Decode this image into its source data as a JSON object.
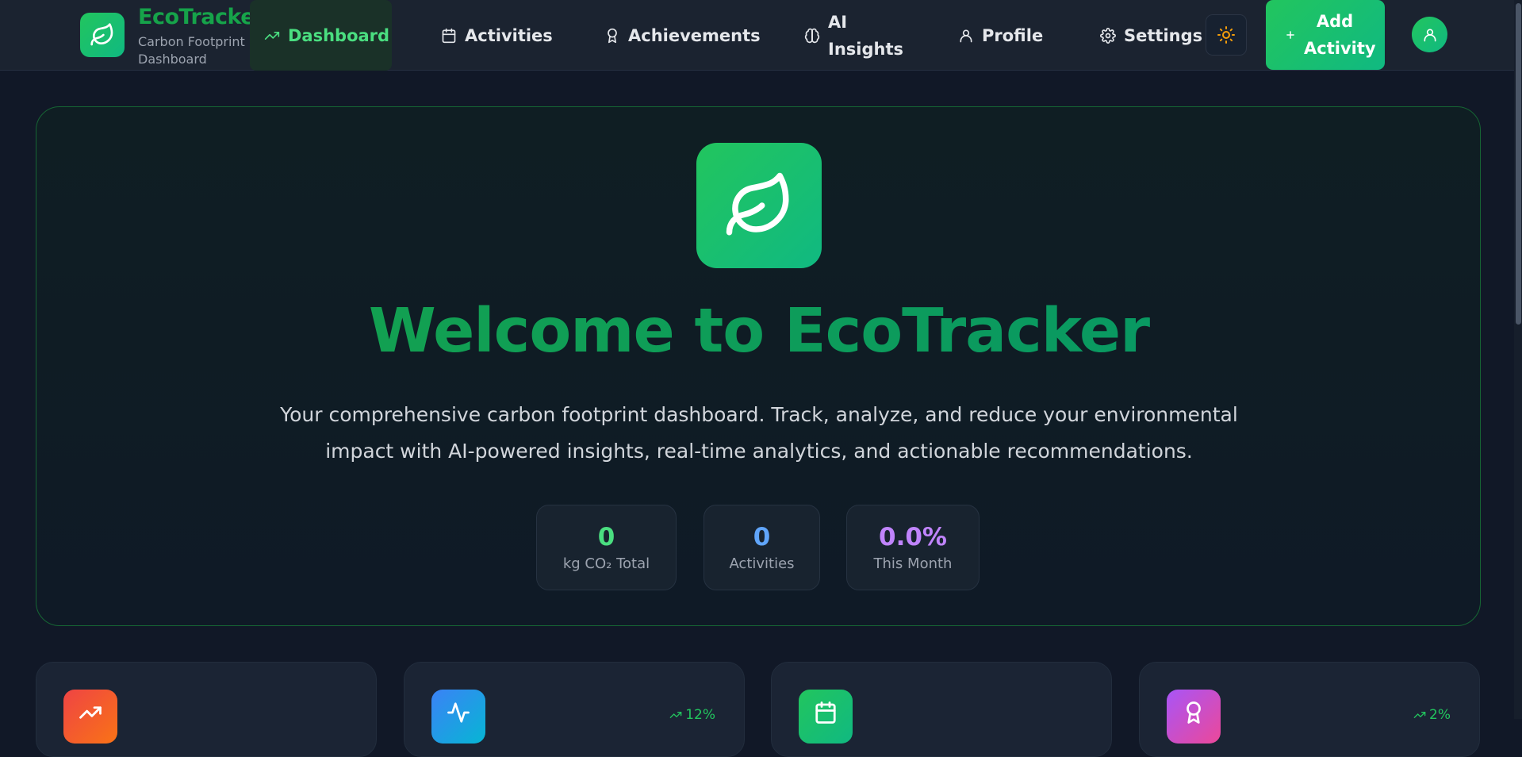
{
  "brand": {
    "name": "EcoTracker",
    "subtitle": "Carbon Footprint Dashboard",
    "icon": "leaf-icon"
  },
  "nav": {
    "items": [
      {
        "label": "Dashboard",
        "icon": "trending-up-icon",
        "active": true
      },
      {
        "label": "Activities",
        "icon": "calendar-icon",
        "active": false
      },
      {
        "label": "Achievements",
        "icon": "award-icon",
        "active": false
      },
      {
        "label": "AI Insights",
        "icon": "brain-icon",
        "active": false
      },
      {
        "label": "Profile",
        "icon": "user-icon",
        "active": false
      },
      {
        "label": "Settings",
        "icon": "gear-icon",
        "active": false
      }
    ],
    "theme_toggle_icon": "sun-icon",
    "add_activity_label": "Add Activity",
    "add_activity_icon": "plus-icon",
    "avatar_icon": "user-icon"
  },
  "hero": {
    "title": "Welcome to EcoTracker",
    "description": "Your comprehensive carbon footprint dashboard. Track, analyze, and reduce your environmental impact with AI-powered insights, real-time analytics, and actionable recommendations.",
    "stats": [
      {
        "value": "0",
        "label": "kg CO₂ Total",
        "color": "#4ade80"
      },
      {
        "value": "0",
        "label": "Activities",
        "color": "#60a5fa"
      },
      {
        "value": "0.0%",
        "label": "This Month",
        "color": "#c084fc"
      }
    ]
  },
  "cards": [
    {
      "icon": "trending-up-icon",
      "trend": "",
      "gradient": [
        "#ef4444",
        "#f97316"
      ]
    },
    {
      "icon": "activity-icon",
      "trend": "12%",
      "gradient": [
        "#3b82f6",
        "#06b6d4"
      ]
    },
    {
      "icon": "calendar-icon",
      "trend": "",
      "gradient": [
        "#22c55e",
        "#10b981"
      ]
    },
    {
      "icon": "award-icon",
      "trend": "2%",
      "gradient": [
        "#a855f7",
        "#ec4899"
      ]
    }
  ],
  "colors": {
    "accent": "#16a34a",
    "background": "#111827",
    "nav_background": "#1b2330",
    "active_tab_background": "#1a3128",
    "theme_icon": "#f59e0b"
  }
}
